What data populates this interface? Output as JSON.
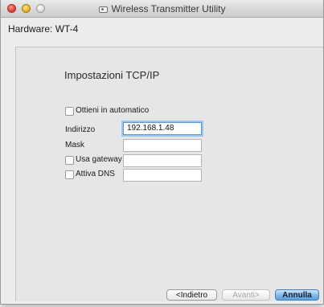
{
  "window": {
    "title": "Wireless Transmitter Utility",
    "app_icon": "wireless-transmitter-icon"
  },
  "hardware": {
    "label": "Hardware: WT-4"
  },
  "section": {
    "heading": "Impostazioni TCP/IP"
  },
  "form": {
    "auto_label": "Ottieni in automatico",
    "auto_checked": false,
    "address_label": "Indirizzo",
    "address_value": "192.168.1.48",
    "mask_label": "Mask",
    "mask_value": "",
    "gateway_label": "Usa gateway",
    "gateway_checked": false,
    "gateway_value": "",
    "dns_label": "Attiva DNS",
    "dns_checked": false,
    "dns_value": ""
  },
  "buttons": {
    "back": "<Indietro",
    "next": "Avanti>",
    "cancel": "Annulla"
  }
}
